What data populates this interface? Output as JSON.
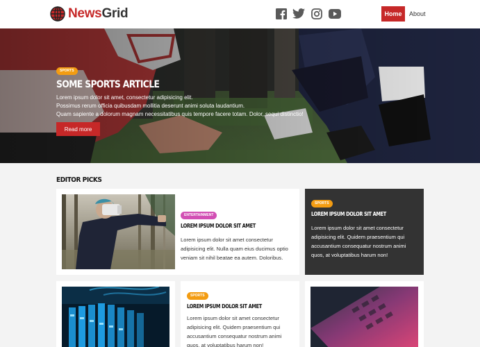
{
  "brand": {
    "name_part1": "News",
    "name_part2": "Grid",
    "accent": "#c62828"
  },
  "nav": {
    "home": "Home",
    "about": "About"
  },
  "social": [
    "facebook-icon",
    "twitter-icon",
    "instagram-icon",
    "youtube-icon"
  ],
  "hero": {
    "badge": "SPORTS",
    "title": "SOME SPORTS ARTICLE",
    "line1": "Lorem ipsum dolor sit amet, consectetur adipisicing elit.",
    "line2": "Possimus rerum officia quibusdam mollitia deserunt animi soluta laudantium.",
    "line3": "Quam sapiente a dolorum magnam necessitatibus quis tempore facere totam. Dolor, sequi distinctio!",
    "button": "Read more"
  },
  "section": {
    "title": "EDITOR PICKS"
  },
  "cards": {
    "vr": {
      "badge": "ENTERTAINMENT",
      "title": "LOREM IPSUM DOLOR SIT AMET",
      "text": "Lorem ipsum dolor sit amet consectetur adipisicing elit. Nulla quam eius ducimus optio veniam sit nihil beatae ea autem. Doloribus."
    },
    "dark": {
      "badge": "SPORTS",
      "title": "LOREM IPSUM DOLOR SIT AMET",
      "text": "Lorem ipsum dolor sit amet consectetur adipisicing elit. Quidem praesentium qui accusantium consequatur nostrum animi quos, at voluptatibus harum non!"
    },
    "mid": {
      "badge": "SPORTS",
      "title": "LOREM IPSUM DOLOR SIT AMET",
      "text": "Lorem ipsum dolor sit amet consectetur adipisicing elit. Quidem praesentium qui accusantium consequatur nostrum animi quos, at voluptatibus harum non!"
    }
  },
  "colors": {
    "sports_badge": "#f39c12",
    "entertainment_badge": "#d24fb4",
    "dark_card": "#333333"
  }
}
